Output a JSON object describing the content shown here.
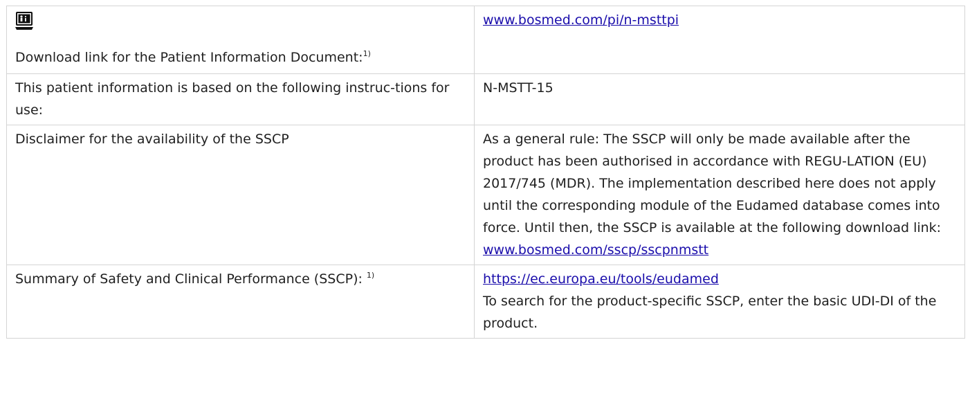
{
  "rows": [
    {
      "label": "Download link for the Patient Information Document:",
      "label_sup": "1)",
      "icon": "laptop-patient-info-icon",
      "link": "www.bosmed.com/pi/n-msttpi"
    },
    {
      "label": "This patient information is based on the following instruc-tions for use:",
      "value": "N-MSTT-15"
    },
    {
      "label": "Disclaimer for the availability of the SSCP",
      "value": "As a general rule: The SSCP will only be made available after the product has been authorised in accordance with REGU-LATION (EU) 2017/745 (MDR). The implementation described here does not apply until the corresponding module of the Eudamed database comes into force. Until then, the SSCP is available at the following download link:",
      "link": "www.bosmed.com/sscp/sscpnmstt"
    },
    {
      "label": "Summary of Safety and Clinical Performance (SSCP): ",
      "label_sup": "1)",
      "link": "https://ec.europa.eu/tools/eudamed",
      "value": "To search for the product-specific SSCP, enter the basic UDI-DI of the product."
    }
  ]
}
